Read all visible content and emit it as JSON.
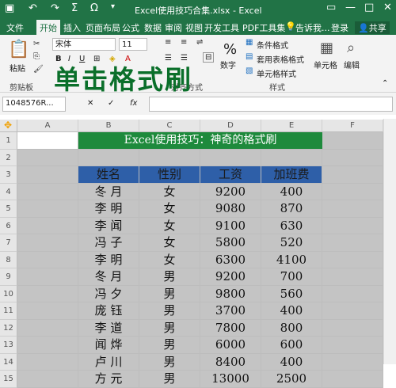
{
  "window": {
    "title": "Excel使用技巧合集.xlsx - Excel"
  },
  "tabs": [
    {
      "label": "文件"
    },
    {
      "label": "开始"
    },
    {
      "label": "插入"
    },
    {
      "label": "页面布局"
    },
    {
      "label": "公式"
    },
    {
      "label": "数据"
    },
    {
      "label": "审阅"
    },
    {
      "label": "视图"
    },
    {
      "label": "开发工具"
    },
    {
      "label": "PDF工具集"
    }
  ],
  "tellme": "告诉我...",
  "login": "登录",
  "share": "共享",
  "ribbon": {
    "paste": "粘贴",
    "clipboard": "剪贴板",
    "font_name": "宋体",
    "font_size": "11",
    "alignment": "对齐方式",
    "number": "数字",
    "cond_format": "条件格式",
    "table_format": "套用表格格式",
    "cell_style": "单元格样式",
    "styles": "样式",
    "cells": "单元格",
    "edit": "编辑"
  },
  "overlay": "单击格式刷",
  "namebox": "1048576R...",
  "columns": [
    "A",
    "B",
    "C",
    "D",
    "E",
    "F"
  ],
  "rows": [
    "1",
    "2",
    "3",
    "4",
    "5",
    "6",
    "7",
    "8",
    "9",
    "10",
    "11",
    "12",
    "13",
    "14",
    "15"
  ],
  "sheet": {
    "title": "Excel使用技巧：神奇的格式刷",
    "headers": [
      "姓名",
      "性别",
      "工资",
      "加班费"
    ],
    "data": [
      [
        "冬 月",
        "女",
        "9200",
        "400"
      ],
      [
        "李 明",
        "女",
        "9080",
        "870"
      ],
      [
        "李 闻",
        "女",
        "9100",
        "630"
      ],
      [
        "冯 子",
        "女",
        "5800",
        "520"
      ],
      [
        "李 明",
        "女",
        "6300",
        "4100"
      ],
      [
        "冬 月",
        "男",
        "9200",
        "700"
      ],
      [
        "冯 夕",
        "男",
        "9800",
        "560"
      ],
      [
        "庞 钰",
        "男",
        "3700",
        "400"
      ],
      [
        "李 道",
        "男",
        "7800",
        "800"
      ],
      [
        "闻 烨",
        "男",
        "6000",
        "600"
      ],
      [
        "卢 川",
        "男",
        "8400",
        "400"
      ],
      [
        "方 元",
        "男",
        "13000",
        "2500"
      ]
    ]
  },
  "colors": {
    "excel_green": "#217346",
    "title_green": "#1e8a3c",
    "header_blue": "#2e5fa8",
    "cell_gray": "#c4c4c4"
  }
}
